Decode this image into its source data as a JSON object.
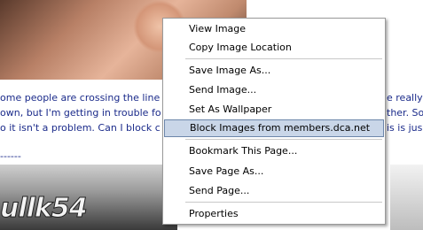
{
  "page": {
    "lines": [
      "ome people are crossing the line",
      "own, but I'm getting in trouble fo",
      "o it isn't a problem. Can I block c"
    ],
    "right_lines": [
      "e really",
      "ther. So",
      "is is jus"
    ],
    "dashes": "------",
    "art_text": "ullk54"
  },
  "menu": {
    "items": [
      {
        "label": "View Image",
        "highlighted": false
      },
      {
        "label": "Copy Image Location",
        "highlighted": false
      },
      {
        "label": "Save Image As...",
        "highlighted": false
      },
      {
        "label": "Send Image...",
        "highlighted": false
      },
      {
        "label": "Set As Wallpaper",
        "highlighted": false
      },
      {
        "label": "Block Images from members.dca.net",
        "highlighted": true
      },
      {
        "label": "Bookmark This Page...",
        "highlighted": false
      },
      {
        "label": "Save Page As...",
        "highlighted": false
      },
      {
        "label": "Send Page...",
        "highlighted": false
      },
      {
        "label": "Properties",
        "highlighted": false
      }
    ]
  }
}
